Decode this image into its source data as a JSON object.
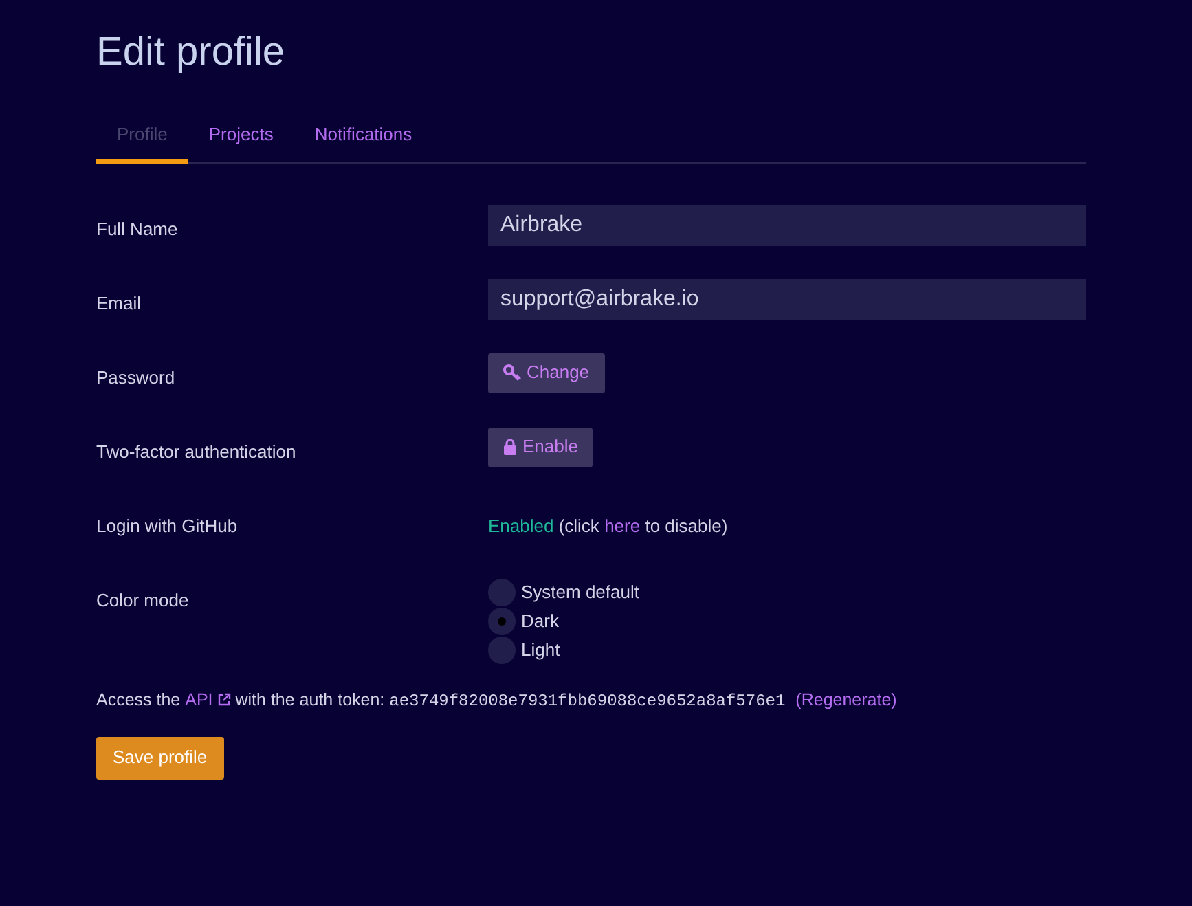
{
  "title": "Edit profile",
  "tabs": [
    {
      "label": "Profile",
      "selected": true
    },
    {
      "label": "Projects",
      "selected": false
    },
    {
      "label": "Notifications",
      "selected": false
    }
  ],
  "fields": [
    {
      "kind": "input",
      "label": "Full Name",
      "value": "Airbrake"
    },
    {
      "kind": "input",
      "label": "Email",
      "value": "support@airbrake.io"
    },
    {
      "kind": "keybutton",
      "label": "Password",
      "button": "Change"
    },
    {
      "kind": "lockbutton",
      "label": "Two-factor authentication",
      "button": "Enable"
    },
    {
      "kind": "status",
      "label": "Login with GitHub",
      "status": "Enabled",
      "before": "(click",
      "link": "here",
      "after": "to disable)"
    },
    {
      "kind": "radio",
      "label": "Color mode",
      "options": [
        {
          "label": "System default",
          "selected": false
        },
        {
          "label": "Dark",
          "selected": true
        },
        {
          "label": "Light",
          "selected": false
        }
      ]
    }
  ],
  "api": {
    "before": "Access the",
    "link": "API",
    "middle": "with the auth token:",
    "token": "ae3749f82008e7931fbb69088ce9652a8af576e1",
    "regenerate": "(Regenerate)"
  },
  "save_button": "Save profile"
}
